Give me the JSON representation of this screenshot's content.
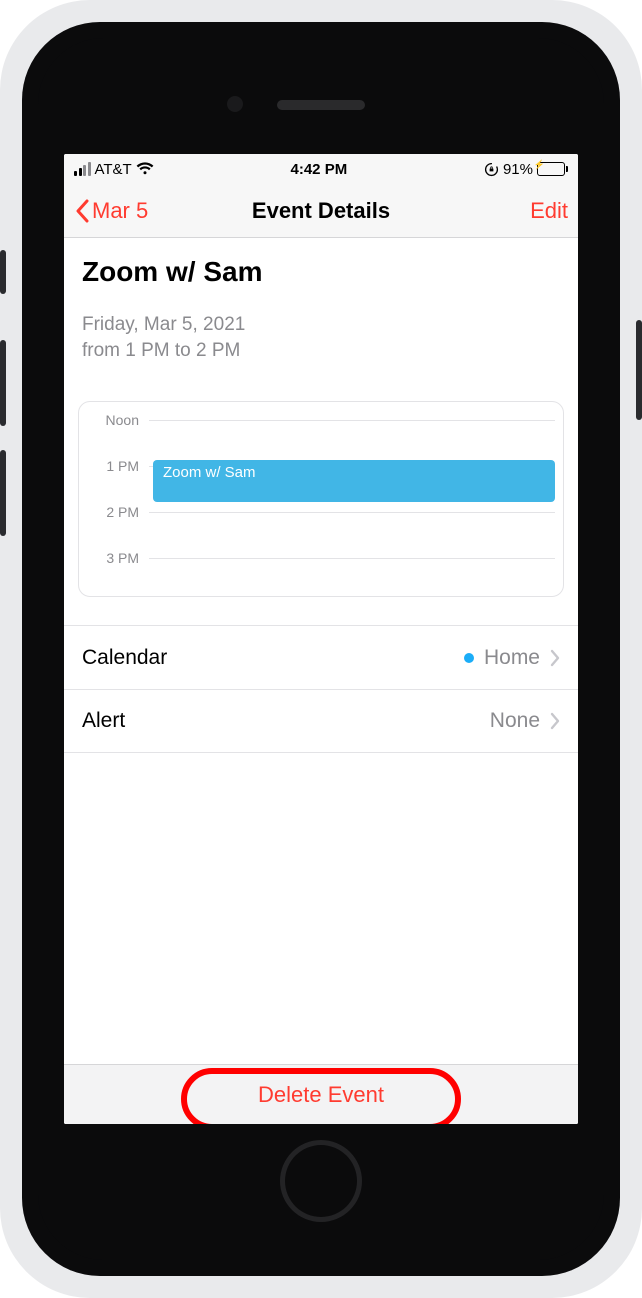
{
  "status_bar": {
    "carrier": "AT&T",
    "time": "4:42 PM",
    "battery_pct": "91%"
  },
  "nav": {
    "back_label": "Mar 5",
    "title": "Event Details",
    "edit_label": "Edit"
  },
  "event": {
    "title": "Zoom w/ Sam",
    "date_line": "Friday, Mar 5, 2021",
    "time_line": "from 1 PM to 2 PM"
  },
  "timeline": {
    "labels": {
      "noon": "Noon",
      "one": "1 PM",
      "two": "2 PM",
      "three": "3 PM"
    },
    "block_label": "Zoom w/ Sam"
  },
  "rows": {
    "calendar": {
      "label": "Calendar",
      "value": "Home"
    },
    "alert": {
      "label": "Alert",
      "value": "None"
    }
  },
  "delete_label": "Delete Event"
}
